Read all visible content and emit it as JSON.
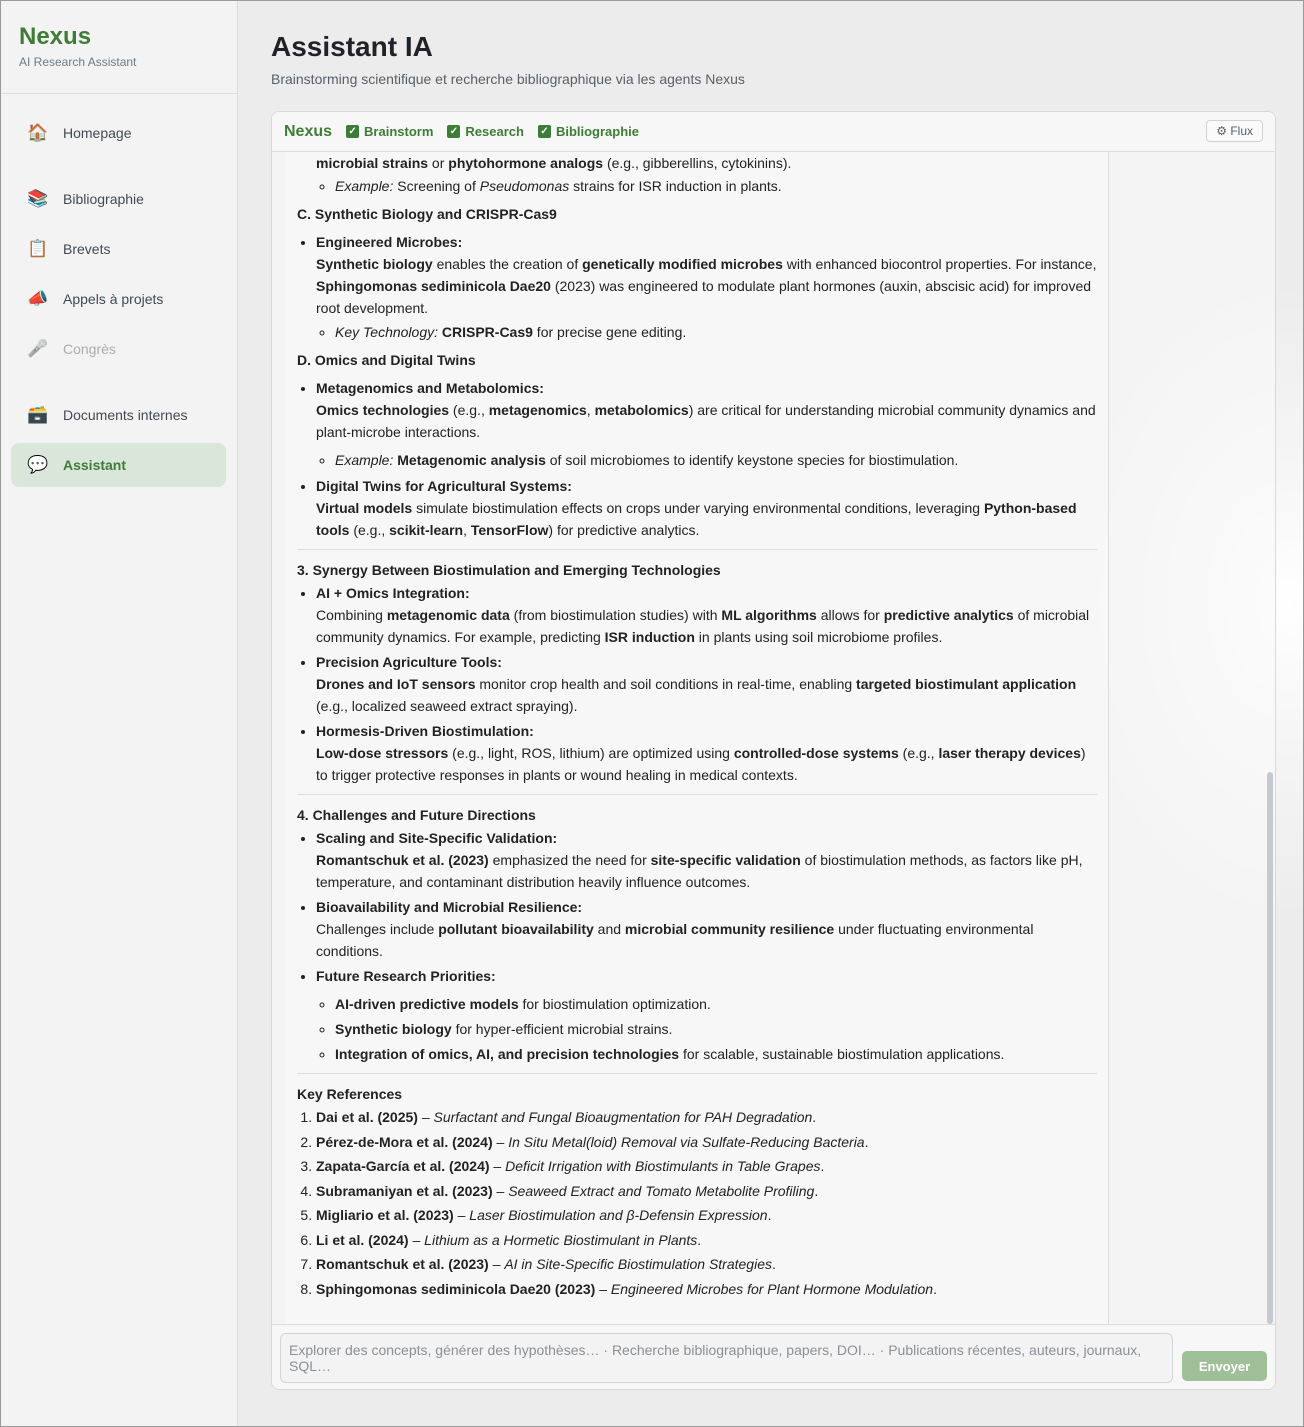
{
  "sidebar": {
    "brand": "Nexus",
    "subtitle": "AI Research Assistant",
    "items": [
      {
        "label": "Homepage",
        "icon": "🏠"
      },
      {
        "label": "Bibliographie",
        "icon": "📚"
      },
      {
        "label": "Brevets",
        "icon": "📋"
      },
      {
        "label": "Appels à projets",
        "icon": "📣"
      },
      {
        "label": "Congrès",
        "icon": "🎤"
      },
      {
        "label": "Documents internes",
        "icon": "🗃️"
      },
      {
        "label": "Assistant",
        "icon": "💬"
      }
    ]
  },
  "header": {
    "title": "Assistant IA",
    "subtitle": "Brainstorming scientifique et recherche bibliographique via les agents Nexus"
  },
  "panel": {
    "brand": "Nexus",
    "agents": [
      "Brainstorm",
      "Research",
      "Bibliographie"
    ],
    "flux_label": "⚙ Flux"
  },
  "message": {
    "top": {
      "cut_line_a": "microbial strains",
      "cut_line_b": " or ",
      "cut_line_c": "phytohormone analogs",
      "cut_line_d": " (e.g., gibberellins, cytokinins).",
      "ex_label": "Example:",
      "ex_a": " Screening of ",
      "ex_b": "Pseudomonas",
      "ex_c": " strains for ISR induction in plants."
    },
    "secC": {
      "title": "C. Synthetic Biology and CRISPR-Cas9",
      "h": "Engineered Microbes:",
      "t1": "Synthetic biology",
      "t2": " enables the creation of ",
      "t3": "genetically modified microbes",
      "t4": " with enhanced biocontrol properties. For instance, ",
      "t5": "Sphingomonas sediminicola Dae20",
      "t6": " (2023) was engineered to modulate plant hormones (auxin, abscisic acid) for improved root development.",
      "k_label": "Key Technology:",
      "k_b": "CRISPR-Cas9",
      "k_t": " for precise gene editing."
    },
    "secD": {
      "title": "D. Omics and Digital Twins",
      "h1": "Metagenomics and Metabolomics:",
      "a1": "Omics technologies",
      "a2": " (e.g., ",
      "a3": "metagenomics",
      "a4": ", ",
      "a5": "metabolomics",
      "a6": ") are critical for understanding microbial community dynamics and plant-microbe interactions.",
      "e_label": "Example:",
      "e_b": "Metagenomic analysis",
      "e_t": " of soil microbiomes to identify keystone species for biostimulation.",
      "h2": "Digital Twins for Agricultural Systems:",
      "b1": "Virtual models",
      "b2": " simulate biostimulation effects on crops under varying environmental conditions, leveraging ",
      "b3": "Python-based tools",
      "b4": " (e.g., ",
      "b5": "scikit-learn",
      "b6": ", ",
      "b7": "TensorFlow",
      "b8": ") for predictive analytics."
    },
    "sec3": {
      "title": "3. Synergy Between Biostimulation and Emerging Technologies",
      "h1": "AI + Omics Integration:",
      "a1": "Combining ",
      "a2": "metagenomic data",
      "a3": " (from biostimulation studies) with ",
      "a4": "ML algorithms",
      "a5": " allows for ",
      "a6": "predictive analytics",
      "a7": " of microbial community dynamics. For example, predicting ",
      "a8": "ISR induction",
      "a9": " in plants using soil microbiome profiles.",
      "h2": "Precision Agriculture Tools:",
      "b1": "Drones and IoT sensors",
      "b2": " monitor crop health and soil conditions in real-time, enabling ",
      "b3": "targeted biostimulant application",
      "b4": " (e.g., localized seaweed extract spraying).",
      "h3": "Hormesis-Driven Biostimulation:",
      "c1": "Low-dose stressors",
      "c2": " (e.g., light, ROS, lithium) are optimized using ",
      "c3": "controlled-dose systems",
      "c4": " (e.g., ",
      "c5": "laser therapy devices",
      "c6": ") to trigger protective responses in plants or wound healing in medical contexts."
    },
    "sec4": {
      "title": "4. Challenges and Future Directions",
      "h1": "Scaling and Site-Specific Validation:",
      "a1": "Romantschuk et al. (2023)",
      "a2": " emphasized the need for ",
      "a3": "site-specific validation",
      "a4": " of biostimulation methods, as factors like pH, temperature, and contaminant distribution heavily influence outcomes.",
      "h2": "Bioavailability and Microbial Resilience:",
      "b1": "Challenges include ",
      "b2": "pollutant bioavailability",
      "b3": " and ",
      "b4": "microbial community resilience",
      "b5": " under fluctuating environmental conditions.",
      "h3": "Future Research Priorities:",
      "p1b": "AI-driven predictive models",
      "p1t": " for biostimulation optimization.",
      "p2b": "Synthetic biology",
      "p2t": " for hyper-efficient microbial strains.",
      "p3b": "Integration of omics, AI, and precision technologies",
      "p3t": " for scalable, sustainable biostimulation applications."
    },
    "refs": {
      "title": "Key References",
      "items": [
        {
          "a": "Dai et al. (2025)",
          "t": "Surfactant and Fungal Bioaugmentation for PAH Degradation"
        },
        {
          "a": "Pérez-de-Mora et al. (2024)",
          "t": "In Situ Metal(loid) Removal via Sulfate-Reducing Bacteria"
        },
        {
          "a": "Zapata-García et al. (2024)",
          "t": "Deficit Irrigation with Biostimulants in Table Grapes"
        },
        {
          "a": "Subramaniyan et al. (2023)",
          "t": "Seaweed Extract and Tomato Metabolite Profiling"
        },
        {
          "a": "Migliario et al. (2023)",
          "t": "Laser Biostimulation and β-Defensin Expression"
        },
        {
          "a": "Li et al. (2024)",
          "t": "Lithium as a Hormetic Biostimulant in Plants"
        },
        {
          "a": "Romantschuk et al. (2023)",
          "t": "AI in Site-Specific Biostimulation Strategies"
        },
        {
          "a": "Sphingomonas sediminicola Dae20 (2023)",
          "t": "Engineered Microbes for Plant Hormone Modulation"
        }
      ],
      "dash": " – ",
      "dot": "."
    }
  },
  "composer": {
    "placeholder": "Explorer des concepts, générer des hypothèses… · Recherche bibliographique, papers, DOI… · Publications récentes, auteurs, journaux, SQL…",
    "send_label": "Envoyer"
  }
}
